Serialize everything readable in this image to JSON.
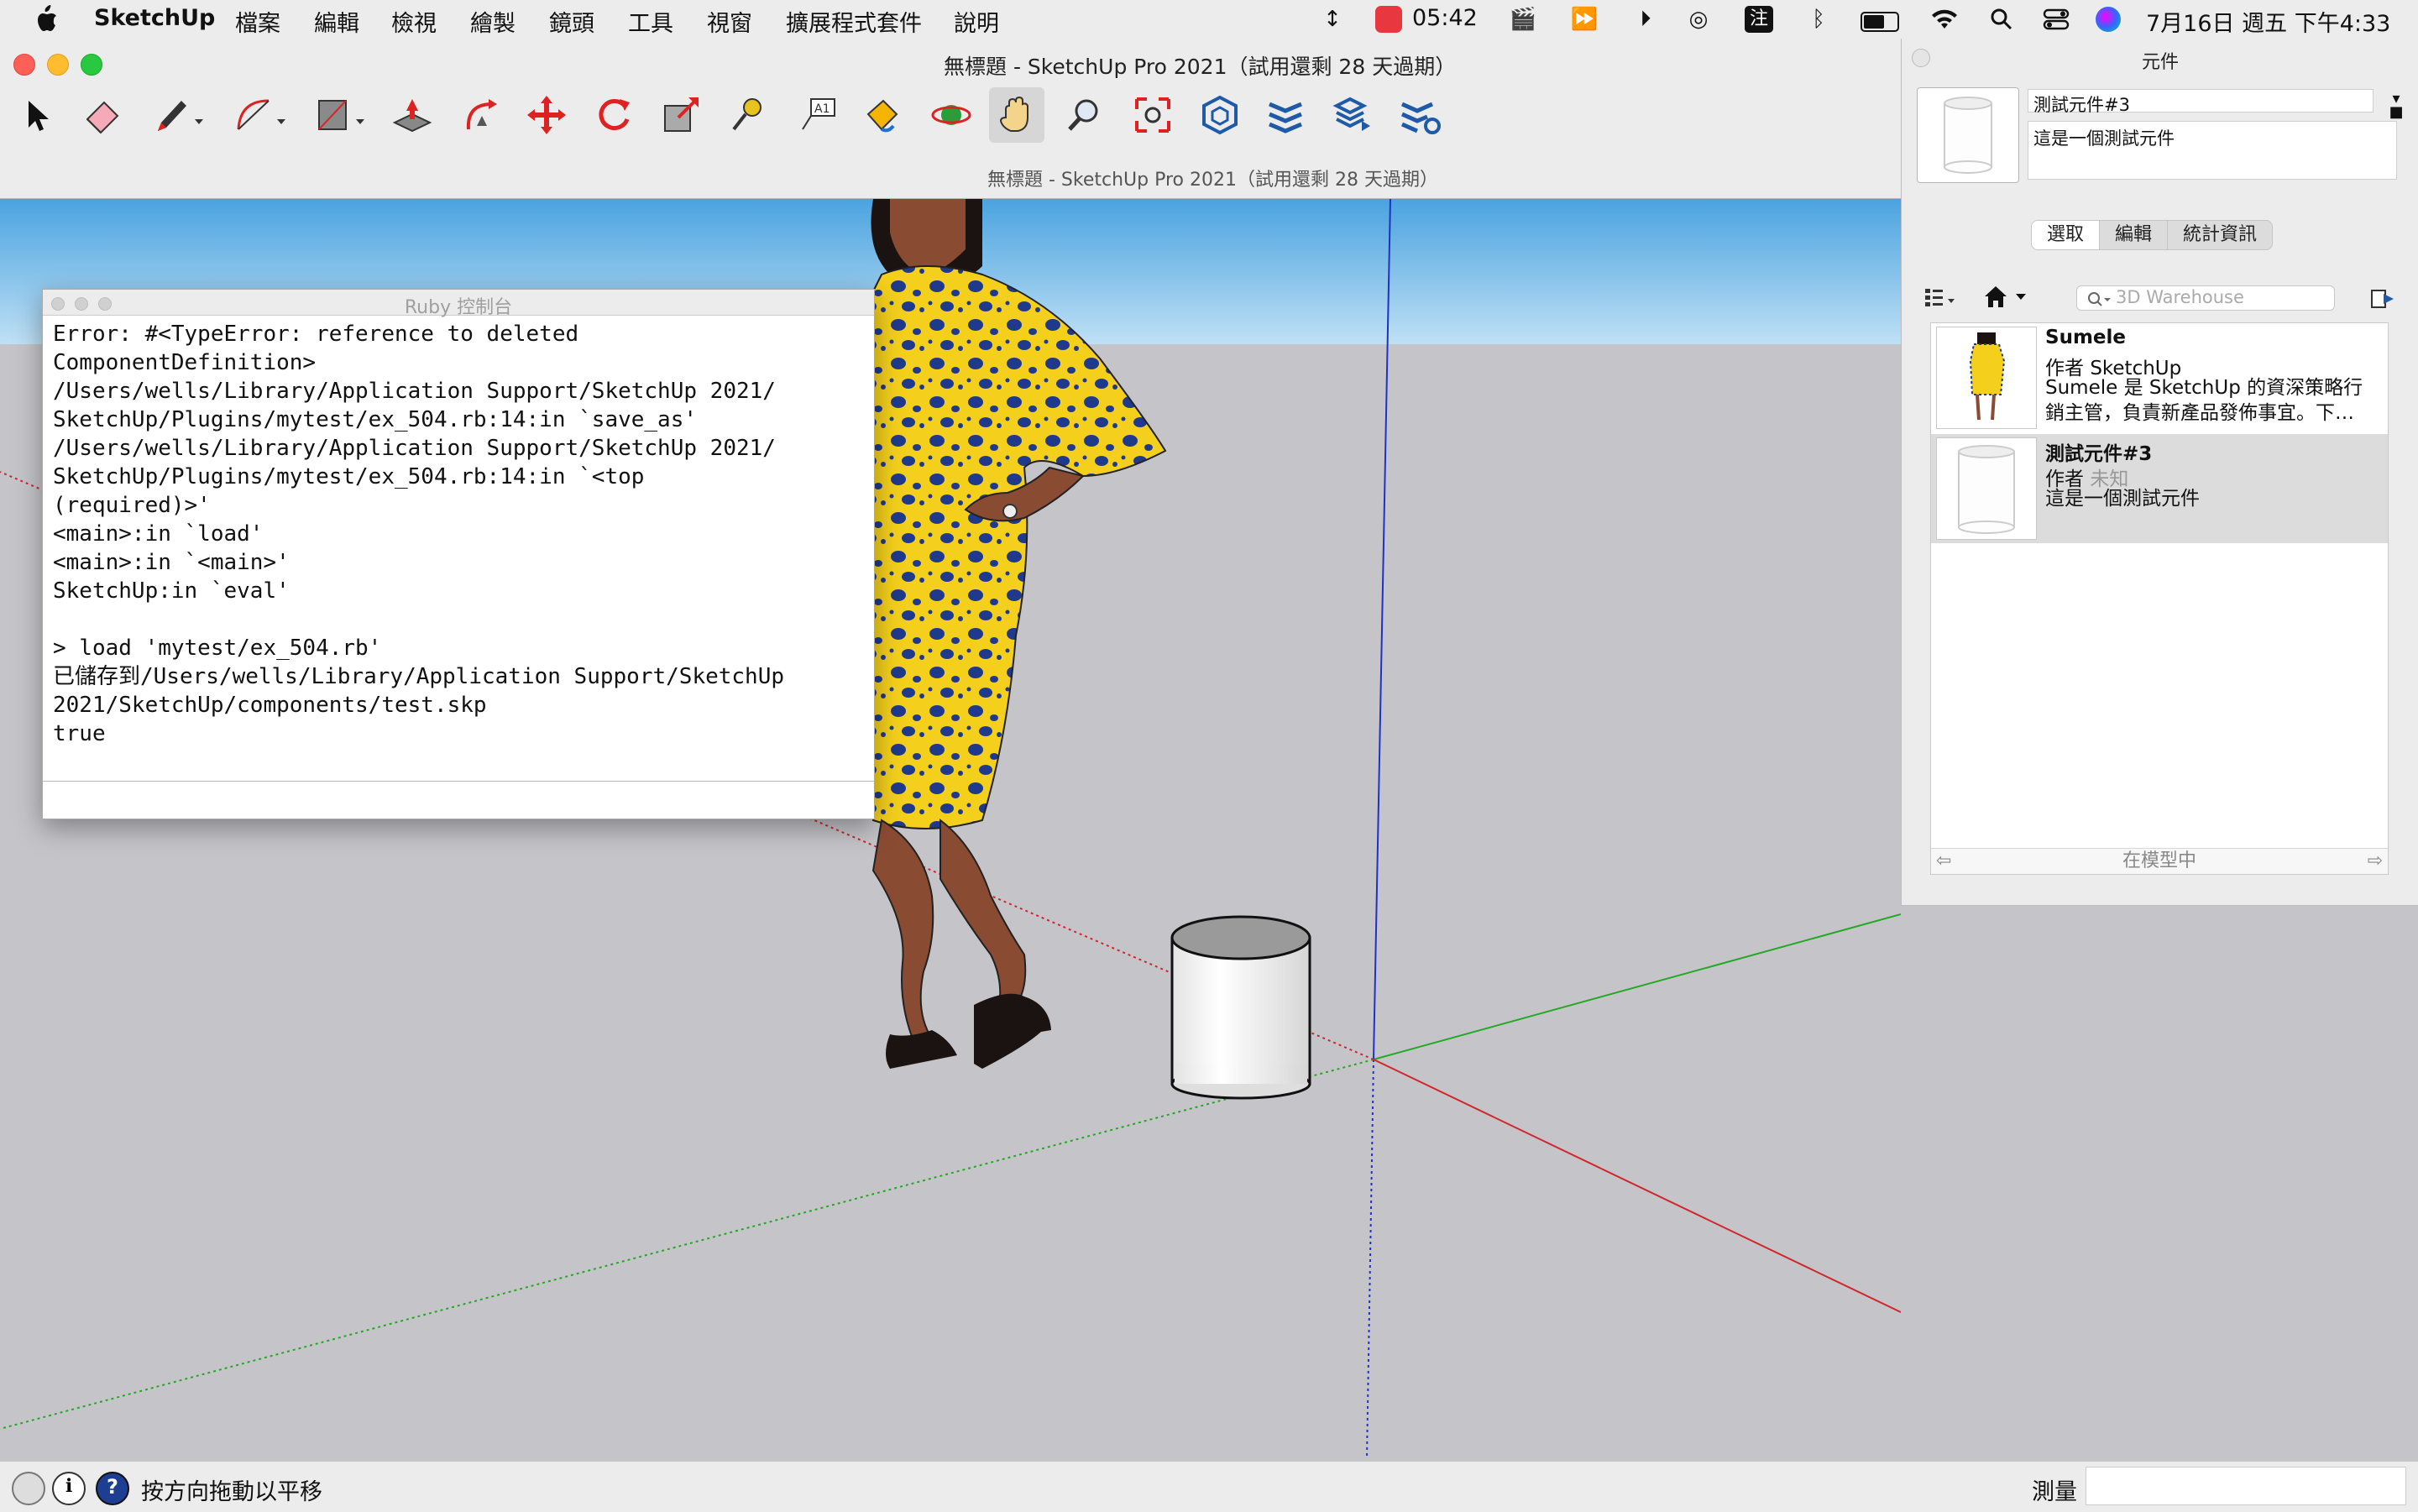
{
  "menubar": {
    "app_name": "SketchUp",
    "menus": [
      "檔案",
      "編輯",
      "檢視",
      "繪製",
      "鏡頭",
      "工具",
      "視窗",
      "擴展程式套件",
      "說明"
    ],
    "clock_badge": "05:42",
    "datetime": "7月16日 週五 下午4:33",
    "input_method": "注"
  },
  "window": {
    "title": "無標題 - SketchUp Pro 2021（試用還剩 28 天過期）",
    "subtitle": "無標題 - SketchUp Pro 2021（試用還剩 28 天過期）"
  },
  "toolbar": {
    "active_tool": "pan",
    "tools": [
      "select",
      "eraser",
      "pencil",
      "arc",
      "shapes",
      "push-pull",
      "follow-me",
      "move",
      "rotate",
      "scale",
      "tape-measure",
      "text",
      "paint-bucket",
      "orbit",
      "pan",
      "zoom",
      "zoom-extents",
      "warehouse",
      "extension-warehouse",
      "layout",
      "extension-manager"
    ]
  },
  "ruby_console": {
    "title": "Ruby 控制台",
    "lines": [
      "Error: #<TypeError: reference to deleted",
      "ComponentDefinition>",
      "/Users/wells/Library/Application Support/SketchUp 2021/",
      "SketchUp/Plugins/mytest/ex_504.rb:14:in `save_as'",
      "/Users/wells/Library/Application Support/SketchUp 2021/",
      "SketchUp/Plugins/mytest/ex_504.rb:14:in `<top",
      "(required)>'",
      "<main>:in `load'",
      "<main>:in `<main>'",
      "SketchUp:in `eval'",
      "",
      "> load 'mytest/ex_504.rb'",
      "已儲存到/Users/wells/Library/Application Support/SketchUp",
      "2021/SketchUp/components/test.skp",
      "true"
    ],
    "input_value": ""
  },
  "components_panel": {
    "title": "元件",
    "selected_name": "測試元件#3",
    "selected_description": "這是一個測試元件",
    "tabs": [
      "選取",
      "編輯",
      "統計資訊"
    ],
    "selected_tab": "選取",
    "search_placeholder": "3D Warehouse",
    "items": [
      {
        "name": "Sumele",
        "author_prefix": "作者",
        "author": "SketchUp",
        "description": "Sumele 是 SketchUp 的資深策略行銷主管，負責新產品發佈事宜。下…"
      },
      {
        "name": "測試元件#3",
        "author_prefix": "作者",
        "author": "未知",
        "description": "這是一個測試元件"
      }
    ],
    "footer": "在模型中"
  },
  "statusbar": {
    "hint": "按方向拖動以平移",
    "measure_label": "測量",
    "measure_value": ""
  },
  "colors": {
    "sky_top": "#4aa3e0",
    "ground": "#c5c5c9",
    "axis_red": "#d0262c",
    "axis_green": "#23a823",
    "axis_blue": "#2031c8",
    "dress_yellow": "#f4cf1c",
    "dress_dots": "#1f3a8c"
  }
}
